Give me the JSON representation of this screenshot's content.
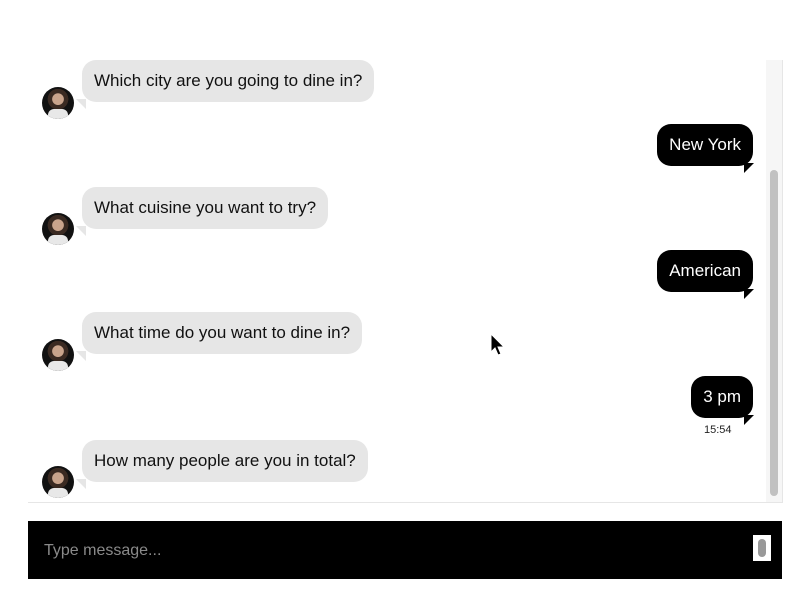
{
  "conversation": [
    {
      "from": "bot",
      "text": "Which city are you going to dine in?"
    },
    {
      "from": "user",
      "text": "New York"
    },
    {
      "from": "bot",
      "text": "What cuisine you want to try?"
    },
    {
      "from": "user",
      "text": "American"
    },
    {
      "from": "bot",
      "text": "What time do you want to dine in?"
    },
    {
      "from": "user",
      "text": "3 pm",
      "timestamp": "15:54"
    },
    {
      "from": "bot",
      "text": "How many people are you in total?"
    }
  ],
  "composer": {
    "placeholder": "Type message...",
    "mic_icon": "microphone-icon"
  },
  "colors": {
    "bot_bubble": "#e6e6e6",
    "user_bubble": "#000000",
    "input_bar": "#000000"
  }
}
